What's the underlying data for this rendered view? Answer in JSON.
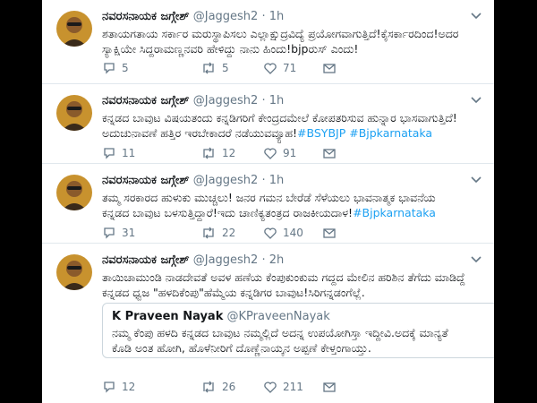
{
  "tweets": [
    {
      "name": "ನವರಸನಾಯಕ ಜಗ್ಗೇಶ್",
      "handle": "@Jaggesh2",
      "dot": "·",
      "time": "1h",
      "text_line1": "ಶತಾಯಗತಾಯ ಸರ್ಕಾರ ಮರುಸ್ಥಾಪಿಸಲು ಎಲ್ಲಾಕ್ಷುದ್ರವಿದ್ಯೆ ಪ್ರಯೋಗವಾಗುತ್ತಿದೆ!ಕೈಸರ್ಕಾರದಿಂದ!ಅದರ",
      "text_line2": "ಸ್ಯಾಕ್ಷಿಯೇ ಸಿದ್ದರಾಮಣ್ಣನವರಿ ಹೇಳಿದ್ದು ನಾನು ಹಿಂದು!bjpರುಸ್ ಎಂದು!",
      "replies": "5",
      "retweets": "5",
      "likes": "71"
    },
    {
      "name": "ನವರಸನಾಯಕ ಜಗ್ಗೇಶ್",
      "handle": "@Jaggesh2",
      "dot": "·",
      "time": "1h",
      "text_line1": "ಕನ್ನಡದ ಬಾವುಟ ವಿಷಯತಂದು ಕನ್ನಡಿಗರಿಗೆ ಕೇಂದ್ರದಮೇಲೆ ಕೋಪತರಿಸುವ ಹುನ್ನಾರ ಭಾಸವಾಗುತ್ತಿದೆ!",
      "text_line2": "ಅದುಚುನಾವಣೆ ಹತ್ತಿರ ಇರಬೇಕಾದರೆ ನಡೆಯುವವ್ಯೂಹ!",
      "tags": "#BSYBJP #Bjpkarnataka",
      "replies": "11",
      "retweets": "12",
      "likes": "91"
    },
    {
      "name": "ನವರಸನಾಯಕ ಜಗ್ಗೇಶ್",
      "handle": "@Jaggesh2",
      "dot": "·",
      "time": "1h",
      "text_line1": "ತಮ್ಮ ಸರಕಾರದ ಹುಳುಕು ಮುಚ್ಚಲು! ಜನರ ಗಮನ ಬೇರೆಡೆ ಸೆಳೆಯಲು ಭಾವನಾತ್ಮಕ ಭಾವನೆಯ",
      "text_line2": "ಕನ್ನಡದ ಬಾವುಟ ಬಳಸುತ್ತಿದ್ದಾರೆ!ಇದು ಚಾಣಿಕ್ಯತಂತ್ರದ ರಾಜಕೀಯದಾಳ!",
      "tags": "#Bjpkarnataka",
      "replies": "31",
      "retweets": "22",
      "likes": "140"
    },
    {
      "name": "ನವರಸನಾಯಕ ಜಗ್ಗೇಶ್",
      "handle": "@Jaggesh2",
      "dot": "·",
      "time": "2h",
      "text_line1": "ತಾಯಿಚಾಮುಂಡಿ ನಾಡದೇವತೆ ಅವಳ ಹಣೆಯ ಕೆಂಪುಕುಂಕುಮ ಗದ್ದದ ಮೇಲಿನ ಹರಿಶಿನ ತೆಗೆದು ಮಾಡಿದ್ದೆ",
      "text_line2": "ಕನ್ನಡದ ಧ್ವಜ \"ಹಳದಿಕೆಂಪು\"ಹೆಮ್ಮೆಯ ಕನ್ನಡಿಗರ ಬಾವುಟ!ಸಿರಿಗನ್ನಡಂಗೆಲ್ಲೆ.",
      "quote": {
        "name": "K Praveen Nayak",
        "handle": "@KPraveenNayak",
        "text_line1": "ನಮ್ಮ ಕೆಂಪು ಹಳದಿ ಕನ್ನಡದ ಬಾವುಟ ನಮ್ಮಲ್ಲಿದೆ ಅದನ್ನ ಉಪಯೋಗಿಸ್ತಾ ಇದ್ದೀವಿ.ಅದಕ್ಕೆ ಮಾನ್ಯತೆ",
        "text_line2": "ಕೊಡಿ ಅಂತ ಹೋಗಿ, ಹೊಳೆನೀರಿಗೆ ದೊಣ್ಣೆನಾಯ್ಕನ ಅಪ್ಪಣೆ ಕೇಳ್ತಂಗಾಯ್ತು."
      },
      "replies": "12",
      "retweets": "26",
      "likes": "211"
    }
  ],
  "icons": {
    "reply": "reply-icon",
    "retweet": "retweet-icon",
    "like": "heart-icon",
    "dm": "envelope-icon",
    "caret": "chevron-down-icon"
  },
  "colors": {
    "hashtag": "#1da1f2",
    "muted": "#657786",
    "text": "#14171a",
    "divider": "#e1e8ed"
  }
}
